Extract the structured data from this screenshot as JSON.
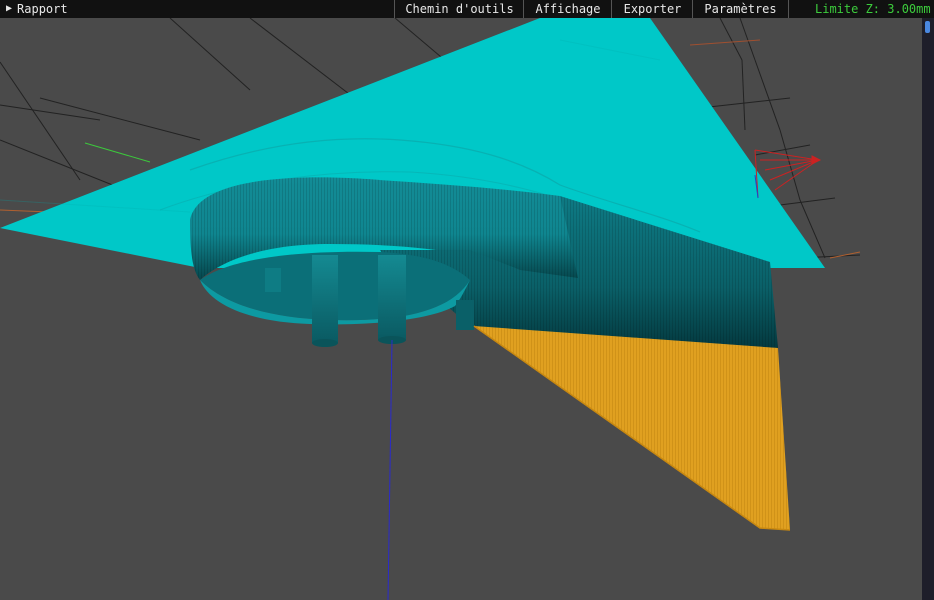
{
  "menubar": {
    "report_label": "Rapport",
    "toolpath_label": "Chemin d'outils",
    "display_label": "Affichage",
    "export_label": "Exporter",
    "settings_label": "Paramètres",
    "zlimit_text": "Limite Z: 3.00mm"
  },
  "colors": {
    "background": "#4a4a4a",
    "menubar": "#111111",
    "menu_text": "#e8e8e8",
    "zlimit_text": "#3ccc3c",
    "plane": "#00c8c8",
    "part": "#0a8e96",
    "toolpath": "#e0a020",
    "grid": "#222222"
  }
}
